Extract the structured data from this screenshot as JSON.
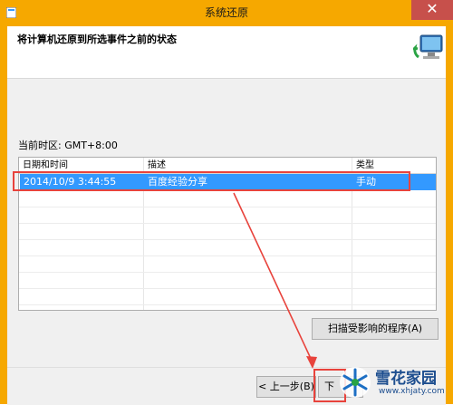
{
  "window": {
    "title": "系统还原",
    "close_glyph": "✕"
  },
  "header": {
    "instruction": "将计算机还原到所选事件之前的状态",
    "icon": "system-restore-icon"
  },
  "timezone": {
    "label": "当前时区: GMT+8:00"
  },
  "restore_list": {
    "columns": [
      "日期和时间",
      "描述",
      "类型"
    ],
    "rows": [
      {
        "date_time": "2014/10/9 3:44:55",
        "description": "百度经验分享",
        "type": "手动",
        "selected": true
      }
    ]
  },
  "buttons": {
    "scan": "扫描受影响的程序(A)",
    "back": "< 上一步(B)",
    "next": "下"
  },
  "watermark": {
    "brand": "雪花家园",
    "url": "www.xhjaty.com"
  },
  "colors": {
    "frame": "#f6a800",
    "selection": "#3399ff",
    "annotation_red": "#e8433c",
    "close_button": "#c7504b"
  }
}
